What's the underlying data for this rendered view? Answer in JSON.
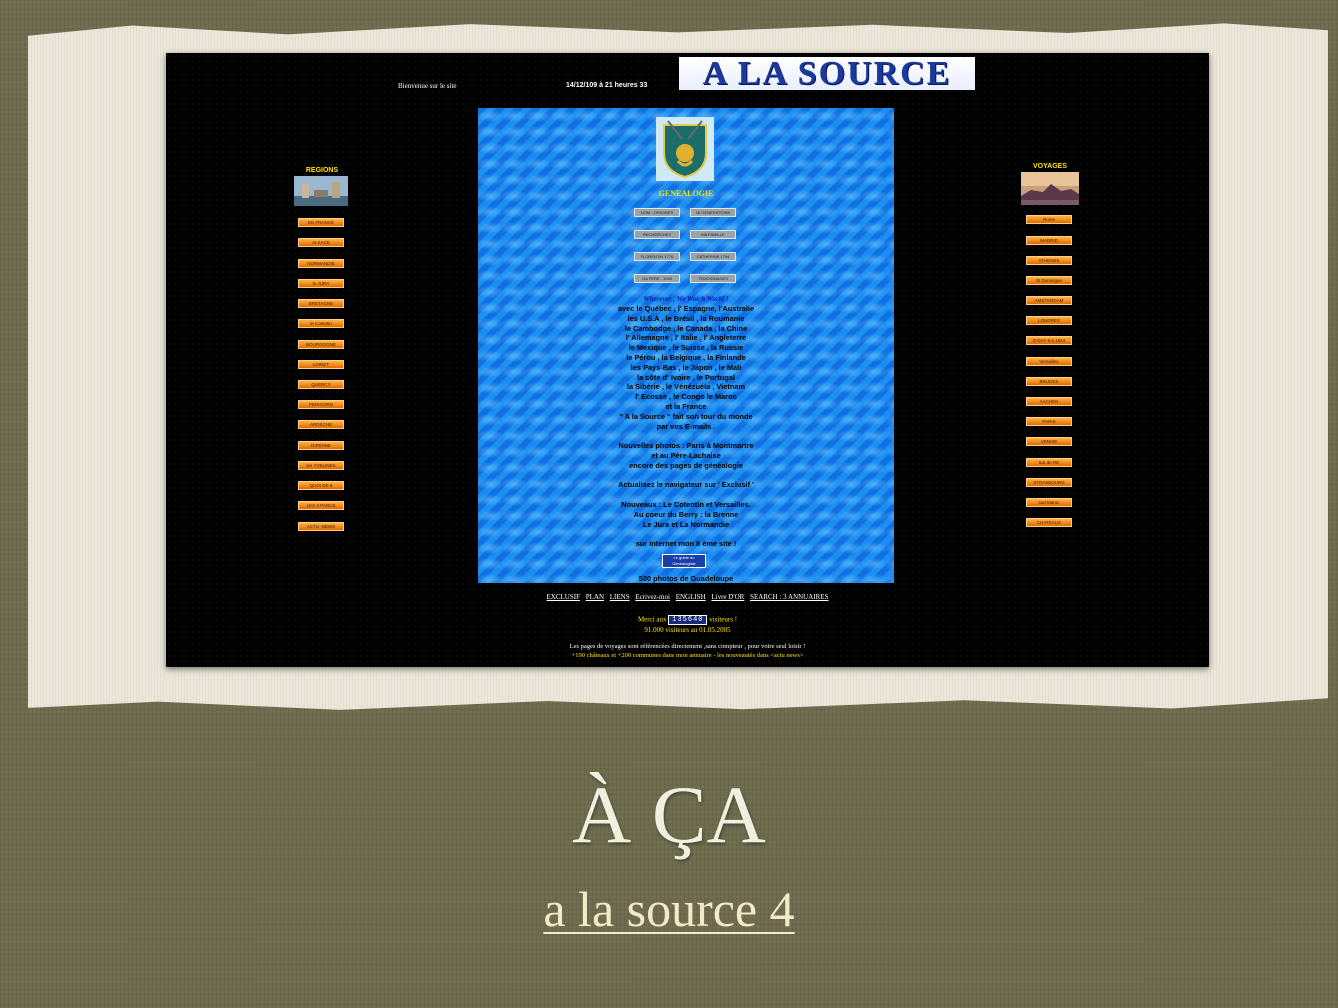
{
  "site": {
    "welcome": "Bienvenue sur le site",
    "datetime": "14/12/109 à 21 heures 33",
    "logo": "A LA SOURCE"
  },
  "regions": {
    "title": "REGIONS",
    "items": [
      "EN FRANCE",
      "ALSACE",
      "NORMANDIE",
      "le JURA",
      "BRETAGNE",
      "le Cotentin",
      "BOURGOGNE",
      "LOIRET",
      "QUERCY",
      "PERIGORD",
      "ARDECHE",
      "DIFENNE",
      "les YVELINES",
      "QUOI DE 9",
      "LES 3 PARCS",
      "ACTU -NEWS"
    ]
  },
  "voyages": {
    "title": "VOYAGES",
    "items": [
      "Rome",
      "MADRID",
      "ATHENES",
      "St Domingue",
      "AMSTERDAM",
      "LONDRES",
      "D-DAY 6.6.1944",
      "Versailles",
      "BRUGES",
      "AACHEN",
      "PARIS",
      "VENISE",
      "ILE de RE",
      "STRASBOURG",
      "sud Maroc",
      "CHATEAUX"
    ]
  },
  "genealogy": {
    "title": "GENEALOGIE",
    "buttons": [
      "NOM - ORIGINES",
      "16 GENERATIONS",
      "RECHERCHES",
      "MA FAMILLE",
      "FLORENTIN 1776",
      "CATHERINE 1794",
      "GA PERE - 1940",
      "TEMOIGNAGES"
    ]
  },
  "content": {
    "motto": "Wherever , We Watch World !",
    "lines": [
      "avec le Québec ,  l' Espagne,  l'Australie",
      "les U.S.A ,  le Brésil , la Roumanie",
      "le Cambodge , le Canada ,  la Chine",
      "l' Allemagne , l' Italie , l' Angleterre",
      "le Mexique , le Suisse ,  la Russie",
      "le Pérou , la Belgique , la Finlande",
      "les Pays-Bas ,  le  Japon ,  le  Mali",
      "la  côte  d' Ivoire , le  Portugal",
      "la  Sibérie , le  Vénézuéla , Vietnam",
      "l' Ecosse , le  Congo  le  Maroc",
      "et  la France",
      "\" A la Source \"  fait  son  tour  du  monde",
      "par  vos E-mails  .",
      "",
      "Nouvelles photos  :  Paris  à  Montmartre",
      "et  au  Père-Lachaise",
      "encore  des  pages  de  généalogie",
      "",
      "Actualisez  le  navigateur  sur ' Exclusif '",
      "",
      "Nouveaux : Le Cotentin  et  Versailles.",
      "Au  coeur  du  Berry :  la  Brenne",
      "Le  Jura  et  La  Normandie",
      "",
      "sur  Internet  mon  8  ème  site   !"
    ],
    "guide_button": "Le guide du Généalogiste",
    "guadeloupe": "500  photos  de  Guadeloupe"
  },
  "footer": {
    "links": [
      "EXCLUSIF",
      "PLAN",
      "LIENS",
      "Ecrivez-moi",
      "ENGLISH",
      "Livre D'OR",
      "SEARCH : 3  ANNUAIRES"
    ],
    "thanks_prefix": "Merci  aux",
    "counter": "135640",
    "thanks_suffix": "visiteurs !",
    "visitors_line": "91.000  visiteurs  au  01.05.2005",
    "note1": "Les pages de voyages sont référencées  directement ,sans compteur , pour votre seul  loisir !",
    "note2": "+190  châteaux  et  +200  communes  dans  mon  annuaire  -  les  nouveautés  dans  <actu news>"
  },
  "slide": {
    "title": "À ÇA",
    "link": "a la source 4"
  },
  "colors": {
    "background": "#6e6a4d",
    "paper": "#ece7da",
    "site_background": "#000000",
    "panel_blue": "#1b8ef0",
    "button_orange": "#f29a1f",
    "accent_yellow": "#ffe000"
  }
}
